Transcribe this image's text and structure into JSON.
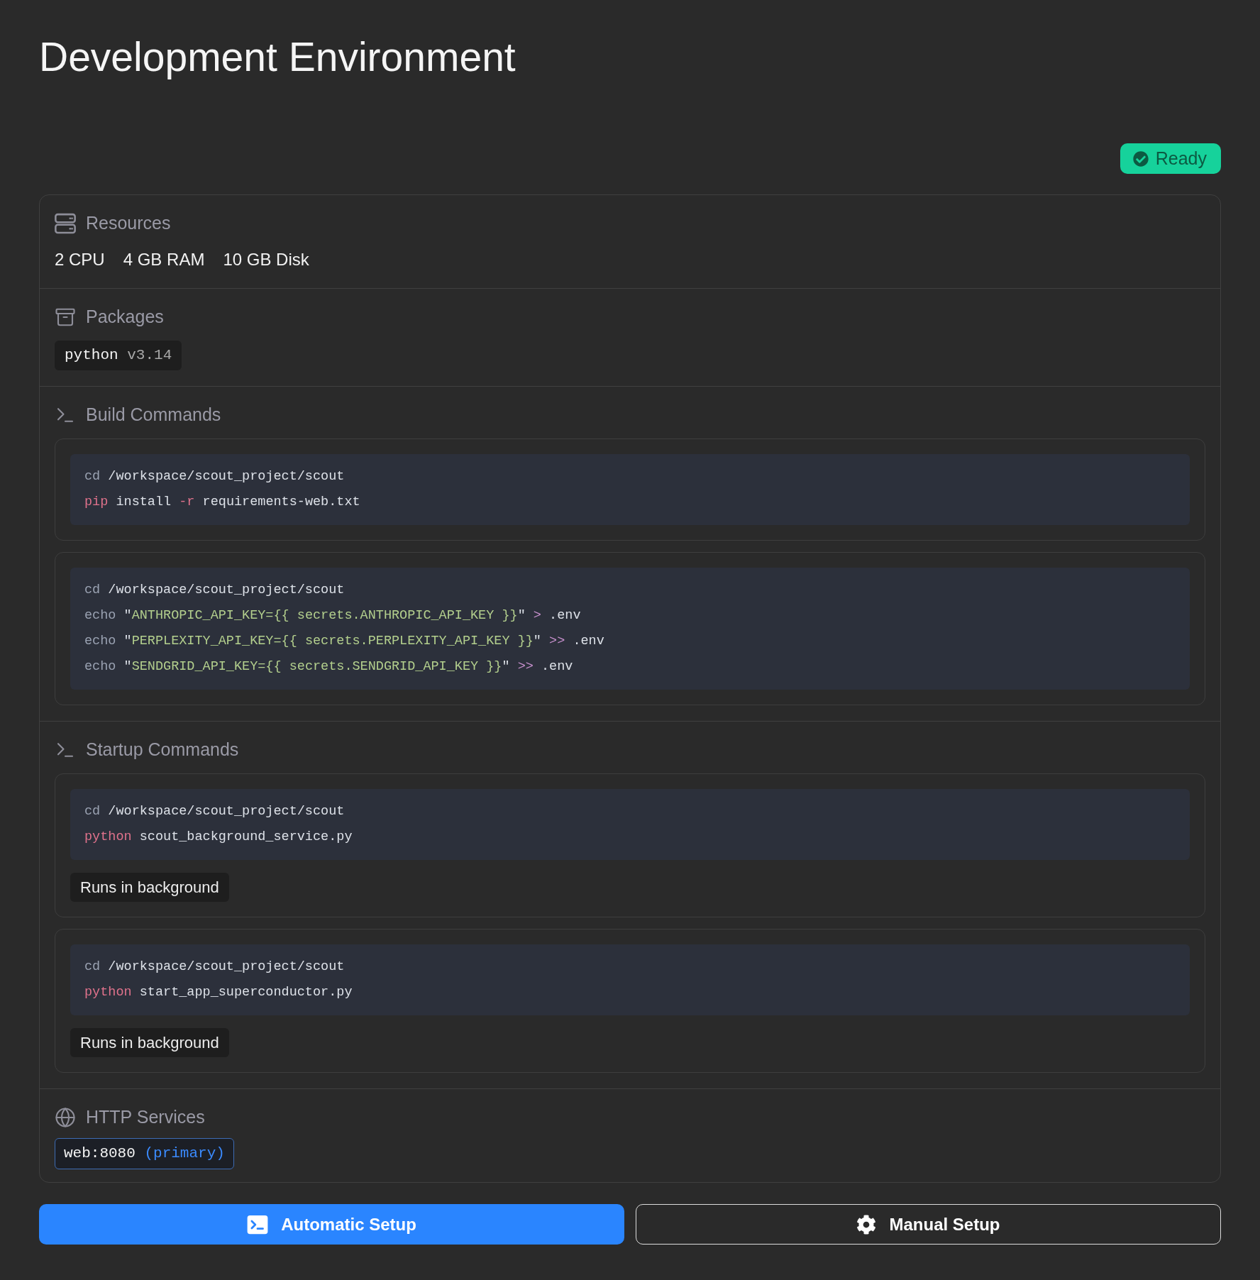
{
  "page": {
    "title": "Development Environment"
  },
  "status": {
    "label": "Ready",
    "kind": "ready"
  },
  "sections": [
    {
      "kind": "resources",
      "title": "Resources",
      "items": [
        "2 CPU",
        "4 GB RAM",
        "10 GB Disk"
      ]
    },
    {
      "kind": "packages",
      "title": "Packages",
      "packages": [
        {
          "name": "python",
          "version": "v3.14"
        }
      ]
    },
    {
      "kind": "commands",
      "title": "Build Commands",
      "commands": [
        {
          "lines": [
            [
              [
                {
                  "text": "cd",
                  "kind": "builtin"
                }
              ],
              [
                {
                  "text": "/workspace/scout_project/scout",
                  "kind": "plain"
                }
              ]
            ],
            [
              [
                {
                  "text": "pip",
                  "kind": "command"
                }
              ],
              [
                {
                  "text": "install",
                  "kind": "plain"
                }
              ],
              [
                {
                  "text": "-r",
                  "kind": "flag"
                }
              ],
              [
                {
                  "text": "requirements-web.txt",
                  "kind": "plain"
                }
              ]
            ]
          ]
        },
        {
          "lines": [
            [
              [
                {
                  "text": "cd",
                  "kind": "builtin"
                }
              ],
              [
                {
                  "text": "/workspace/scout_project/scout",
                  "kind": "plain"
                }
              ]
            ],
            [
              [
                {
                  "text": "echo",
                  "kind": "builtin"
                }
              ],
              [
                {
                  "text": "\"",
                  "kind": "plain"
                },
                {
                  "text": "ANTHROPIC_API_KEY={{ secrets.ANTHROPIC_API_KEY }}",
                  "kind": "string"
                },
                {
                  "text": "\"",
                  "kind": "plain"
                }
              ],
              [
                {
                  "text": ">",
                  "kind": "operator"
                }
              ],
              [
                {
                  "text": ".env",
                  "kind": "plain"
                }
              ]
            ],
            [
              [
                {
                  "text": "echo",
                  "kind": "builtin"
                }
              ],
              [
                {
                  "text": "\"",
                  "kind": "plain"
                },
                {
                  "text": "PERPLEXITY_API_KEY={{ secrets.PERPLEXITY_API_KEY }}",
                  "kind": "string"
                },
                {
                  "text": "\"",
                  "kind": "plain"
                }
              ],
              [
                {
                  "text": ">>",
                  "kind": "operator"
                }
              ],
              [
                {
                  "text": ".env",
                  "kind": "plain"
                }
              ]
            ],
            [
              [
                {
                  "text": "echo",
                  "kind": "builtin"
                }
              ],
              [
                {
                  "text": "\"",
                  "kind": "plain"
                },
                {
                  "text": "SENDGRID_API_KEY={{ secrets.SENDGRID_API_KEY }}",
                  "kind": "string"
                },
                {
                  "text": "\"",
                  "kind": "plain"
                }
              ],
              [
                {
                  "text": ">>",
                  "kind": "operator"
                }
              ],
              [
                {
                  "text": ".env",
                  "kind": "plain"
                }
              ]
            ]
          ]
        }
      ]
    },
    {
      "kind": "commands",
      "title": "Startup Commands",
      "commands": [
        {
          "lines": [
            [
              [
                {
                  "text": "cd",
                  "kind": "builtin"
                }
              ],
              [
                {
                  "text": "/workspace/scout_project/scout",
                  "kind": "plain"
                }
              ]
            ],
            [
              [
                {
                  "text": "python",
                  "kind": "command"
                }
              ],
              [
                {
                  "text": "scout_background_service.py",
                  "kind": "plain"
                }
              ]
            ]
          ],
          "tag": "Runs in background"
        },
        {
          "lines": [
            [
              [
                {
                  "text": "cd",
                  "kind": "builtin"
                }
              ],
              [
                {
                  "text": "/workspace/scout_project/scout",
                  "kind": "plain"
                }
              ]
            ],
            [
              [
                {
                  "text": "python",
                  "kind": "command"
                }
              ],
              [
                {
                  "text": "start_app_superconductor.py",
                  "kind": "plain"
                }
              ]
            ]
          ],
          "tag": "Runs in background"
        }
      ]
    },
    {
      "kind": "services",
      "title": "HTTP Services",
      "services": [
        {
          "name": "web:8080",
          "note": "(primary)",
          "primary": true
        }
      ]
    }
  ],
  "buttons": [
    {
      "label": "Automatic Setup",
      "primary": true
    },
    {
      "label": "Manual Setup",
      "primary": false
    }
  ]
}
